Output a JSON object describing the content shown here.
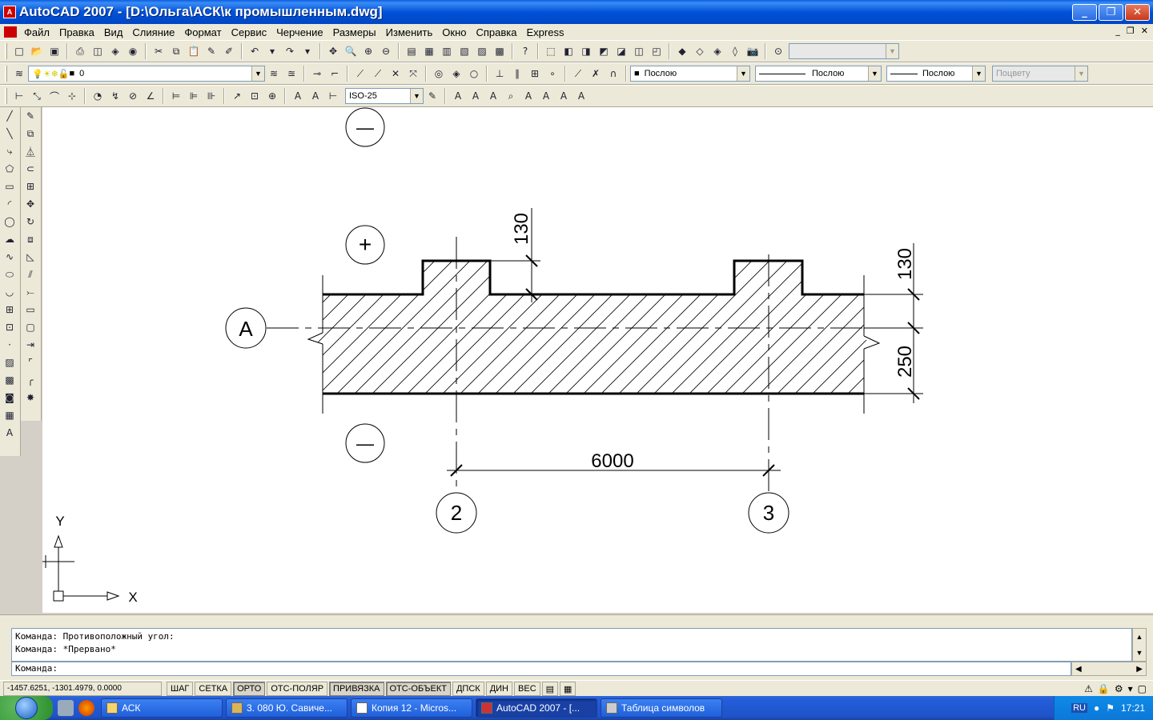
{
  "window": {
    "title": "AutoCAD 2007 - [D:\\Ольга\\АСК\\к промышленным.dwg]",
    "min": "_",
    "max": "❐",
    "close": "✕"
  },
  "menu": [
    "Файл",
    "Правка",
    "Вид",
    "Слияние",
    "Формат",
    "Сервис",
    "Черчение",
    "Размеры",
    "Изменить",
    "Окно",
    "Справка",
    "Express"
  ],
  "layers": {
    "current": "0",
    "color": "Послою",
    "linetype": "Послою",
    "lineweight": "Послою",
    "plotstyle": "Поцвету"
  },
  "dimstyle": "ISO-25",
  "drawing": {
    "axis_A": "A",
    "axis_2": "2",
    "axis_3": "3",
    "plus_sign": "+",
    "minus_sign": "—",
    "dim_130_top": "130",
    "dim_130_right": "130",
    "dim_250": "250",
    "dim_6000": "6000",
    "ucs_x": "X",
    "ucs_y": "Y"
  },
  "command": {
    "history1": "Команда: Противоположный угол:",
    "history2": "Команда: *Прервано*",
    "prompt": "Команда:"
  },
  "status": {
    "coords": "-1457.6251, -1301.4979, 0.0000",
    "buttons": [
      {
        "label": "ШАГ",
        "on": false
      },
      {
        "label": "СЕТКА",
        "on": false
      },
      {
        "label": "ОРТО",
        "on": true
      },
      {
        "label": "ОТС-ПОЛЯР",
        "on": false
      },
      {
        "label": "ПРИВЯЗКА",
        "on": true
      },
      {
        "label": "ОТС-ОБЪЕКТ",
        "on": true
      },
      {
        "label": "ДПСК",
        "on": false
      },
      {
        "label": "ДИН",
        "on": false
      },
      {
        "label": "ВЕС",
        "on": false
      }
    ]
  },
  "taskbar": {
    "tasks": [
      "АСК",
      "3. 080 Ю. Савиче...",
      "Копия 12 - Micros...",
      "AutoCAD 2007 - [...",
      "Таблица символов"
    ],
    "lang": "RU",
    "time": "17:21"
  }
}
